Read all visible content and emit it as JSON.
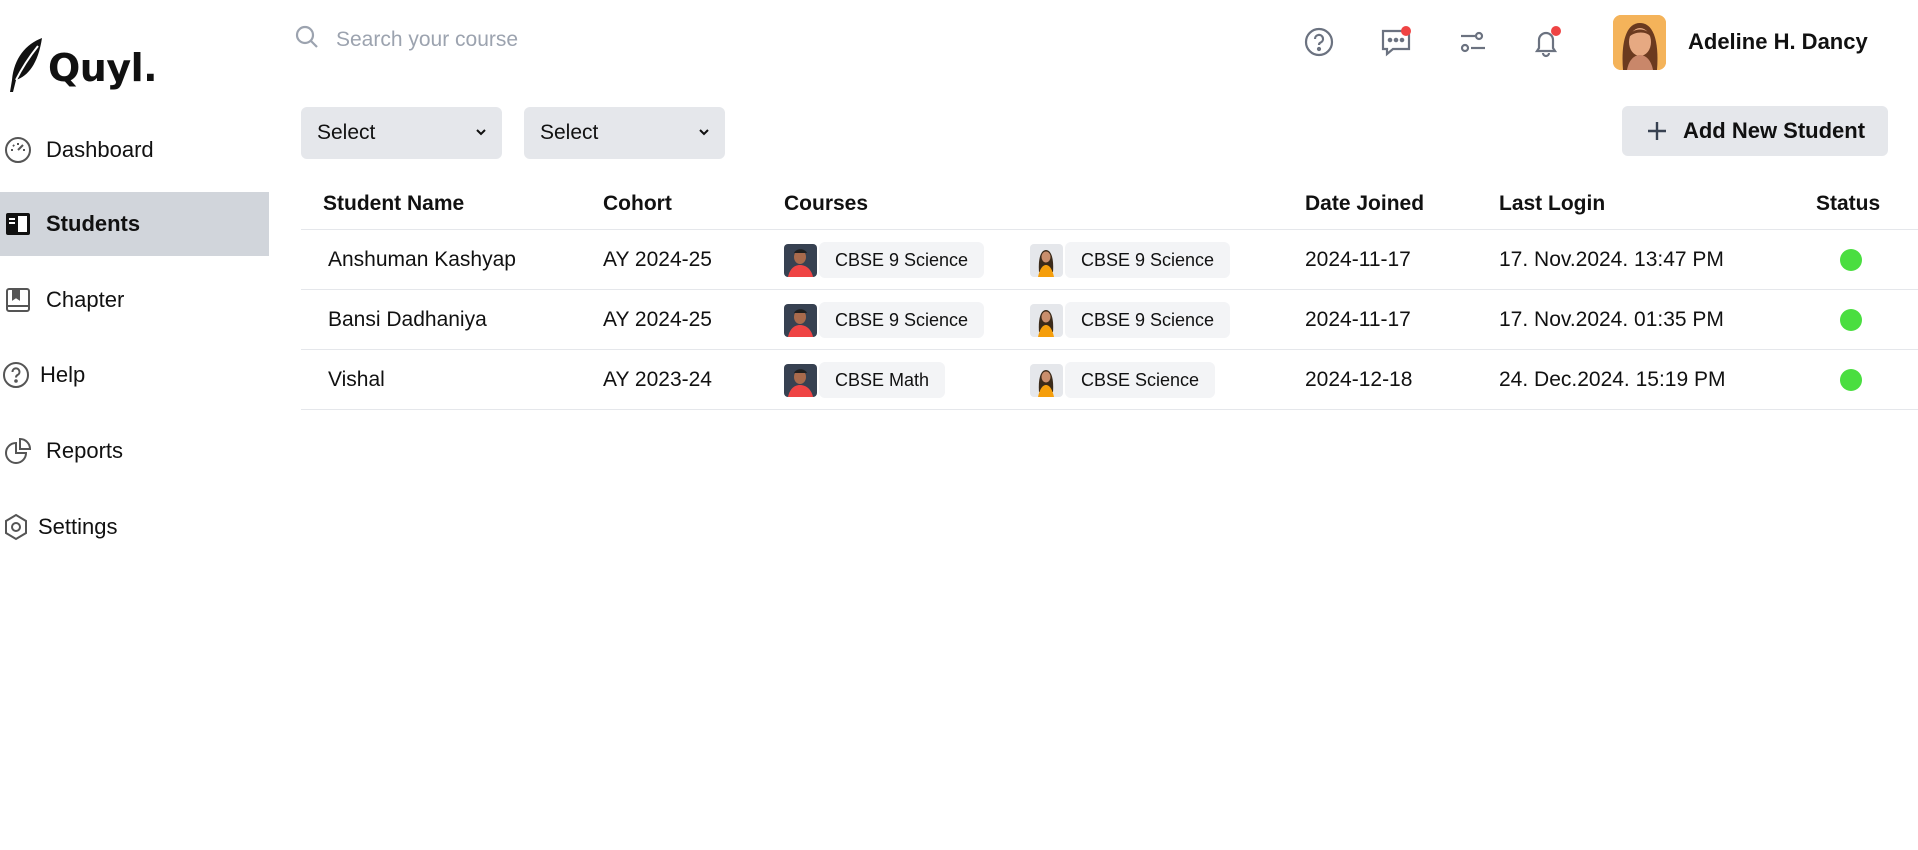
{
  "app": {
    "logo_text": "Quyl."
  },
  "sidebar": {
    "items": [
      {
        "label": "Dashboard",
        "icon": "gauge-icon"
      },
      {
        "label": "Students",
        "icon": "book-open-icon",
        "active": true
      },
      {
        "label": "Chapter",
        "icon": "book-icon"
      },
      {
        "label": "Help",
        "icon": "help-circle-icon"
      },
      {
        "label": "Reports",
        "icon": "pie-chart-icon"
      },
      {
        "label": "Settings",
        "icon": "settings-icon"
      }
    ]
  },
  "header": {
    "search_placeholder": "Search your course",
    "user_name": "Adeline H. Dancy",
    "icons": [
      "help-icon",
      "chat-icon",
      "filter-icon",
      "bell-icon"
    ]
  },
  "filters": {
    "select_1": "Select",
    "select_2": "Select",
    "add_button": "Add New Student"
  },
  "table": {
    "headers": {
      "name": "Student Name",
      "cohort": "Cohort",
      "courses": "Courses",
      "date_joined": "Date Joined",
      "last_login": "Last Login",
      "status": "Status"
    },
    "rows": [
      {
        "name": "Anshuman Kashyap",
        "cohort": "AY 2024-25",
        "course_1": "CBSE 9 Science",
        "course_2": "CBSE 9 Science",
        "date_joined": "2024-11-17",
        "last_login": "17. Nov.2024. 13:47 PM",
        "status_color": "#4ade40"
      },
      {
        "name": "Bansi Dadhaniya",
        "cohort": "AY 2024-25",
        "course_1": "CBSE 9 Science",
        "course_2": "CBSE 9 Science",
        "date_joined": "2024-11-17",
        "last_login": "17. Nov.2024. 01:35 PM",
        "status_color": "#4ade40"
      },
      {
        "name": "Vishal",
        "cohort": "AY 2023-24",
        "course_1": "CBSE Math",
        "course_2": "CBSE Science",
        "date_joined": "2024-12-18",
        "last_login": "24. Dec.2024. 15:19 PM",
        "status_color": "#4ade40"
      }
    ]
  },
  "colors": {
    "active_nav_bg": "#d1d5db",
    "button_bg": "#e5e7eb",
    "chip_bg": "#f3f4f6",
    "notification_dot": "#ef4444",
    "status_active": "#4ade40"
  }
}
